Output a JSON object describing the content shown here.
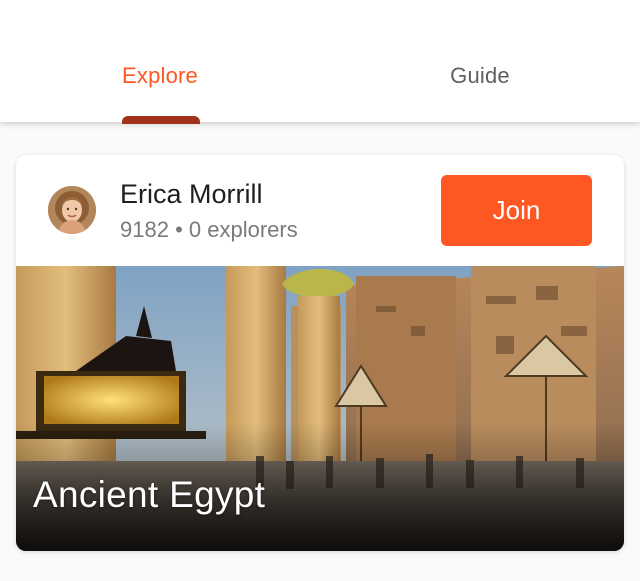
{
  "tabs": [
    {
      "label": "Explore",
      "active": true
    },
    {
      "label": "Guide",
      "active": false
    }
  ],
  "colors": {
    "accent": "#ff5722",
    "indicator": "#a0321a",
    "inactive_tab": "#5f5f5f"
  },
  "card": {
    "owner_name": "Erica Morrill",
    "meta_count": "9182",
    "meta_separator": "•",
    "meta_explorers": "0 explorers",
    "join_label": "Join",
    "title": "Ancient Egypt",
    "avatar_icon": "user-avatar-photo",
    "hero_image": "ancient-egypt-temple-scene"
  }
}
